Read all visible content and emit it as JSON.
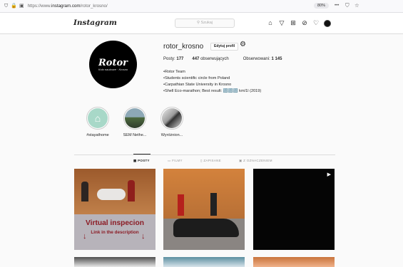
{
  "browser": {
    "url_prefix": "https://www.",
    "url_host": "instagram.com",
    "url_path": "/rotor_krosno/",
    "zoom": "80%",
    "menu_dots": "•••"
  },
  "header": {
    "logo": "Instagram",
    "search_placeholder": "Szukaj"
  },
  "profile": {
    "username": "rotor_krosno",
    "edit_button": "Edytuj profil",
    "avatar_title": "Rotor",
    "avatar_subtitle": "Koło naukowe · Krosno",
    "posts_label": "Posty:",
    "posts_count": "177",
    "followers_count": "447",
    "followers_label": "obserwujących",
    "following_label": "Obserwowani:",
    "following_count": "1 145",
    "bio": [
      "•Rotor Team",
      "•Students scientific circle from Poland",
      "•Carpathian State University in Krosno",
      "•Shell Eco-marathon; Best result: 🔢🔢🔢 km/1l (2019)"
    ]
  },
  "highlights": [
    {
      "label": "#stayathome"
    },
    {
      "label": "SEM Nethe..."
    },
    {
      "label": "Wyróżnion..."
    }
  ],
  "tabs": {
    "posts": "POSTY",
    "films": "FILMY",
    "saved": "ZAPISANE",
    "tagged": "Z OZNACZENIEM"
  },
  "posts": [
    {
      "title": "Virtual inspecion",
      "subtitle": "Link in the description"
    },
    {},
    {}
  ],
  "colors": {
    "accent": "#262626",
    "border": "#dbdbdb",
    "post_title": "#8b1b24"
  }
}
